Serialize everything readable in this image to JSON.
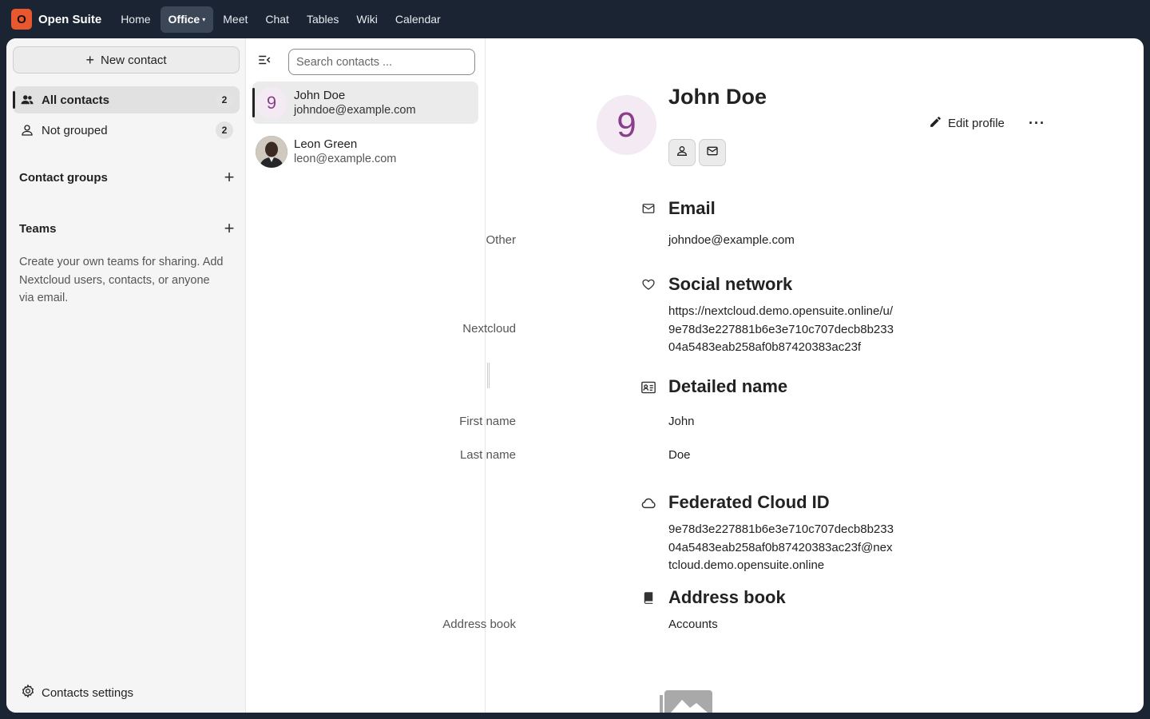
{
  "topbar": {
    "logo_letter": "O",
    "brand": "Open Suite",
    "nav": [
      {
        "label": "Home"
      },
      {
        "label": "Office",
        "active": true
      },
      {
        "label": "Meet"
      },
      {
        "label": "Chat"
      },
      {
        "label": "Tables"
      },
      {
        "label": "Wiki"
      },
      {
        "label": "Calendar"
      }
    ],
    "office_caret": "▾"
  },
  "sidebar": {
    "new_contact_label": "New contact",
    "all_contacts": {
      "label": "All contacts",
      "count": "2"
    },
    "not_grouped": {
      "label": "Not grouped",
      "count": "2"
    },
    "contact_groups_title": "Contact groups",
    "teams_title": "Teams",
    "teams_hint": "Create your own teams for sharing. Add Nextcloud users, contacts, or anyone via email.",
    "settings_label": "Contacts settings"
  },
  "list": {
    "search_placeholder": "Search contacts ...",
    "contacts": [
      {
        "name": "John Doe",
        "email": "johndoe@example.com",
        "avatar_letter": "9"
      },
      {
        "name": "Leon Green",
        "email": "leon@example.com"
      }
    ]
  },
  "detail": {
    "avatar_letter": "9",
    "name": "John Doe",
    "edit_profile_label": "Edit profile",
    "more_label": "···",
    "email": {
      "title": "Email",
      "label": "Other",
      "value": "johndoe@example.com"
    },
    "social": {
      "title": "Social network",
      "label": "Nextcloud",
      "value_lines": [
        "https://nextcloud.demo.opensuite.online/u/",
        "9e78d3e227881b6e3e710c707decb8b233",
        "04a5483eab258af0b87420383ac23f"
      ]
    },
    "detailed_name": {
      "title": "Detailed name",
      "first_label": "First name",
      "first_value": "John",
      "last_label": "Last name",
      "last_value": "Doe"
    },
    "federated": {
      "title": "Federated Cloud ID",
      "value_lines": [
        "9e78d3e227881b6e3e710c707decb8b233",
        "04a5483eab258af0b87420383ac23f@nex",
        "tcloud.demo.opensuite.online"
      ]
    },
    "addressbook": {
      "title": "Address book",
      "label": "Address book",
      "value": "Accounts"
    }
  },
  "colors": {
    "topbar_bg": "#1a2433",
    "logo_bg": "#e9572f",
    "avatar_fg": "#8a3f8a",
    "avatar_bg": "#f3eaf3"
  },
  "icons": [
    "group-icon",
    "user-icon",
    "plus-icon",
    "gear-icon",
    "collapse-list-icon",
    "person-icon",
    "mail-icon",
    "pencil-icon",
    "heart-icon",
    "id-card-icon",
    "cloud-icon",
    "book-icon",
    "image-icon"
  ]
}
